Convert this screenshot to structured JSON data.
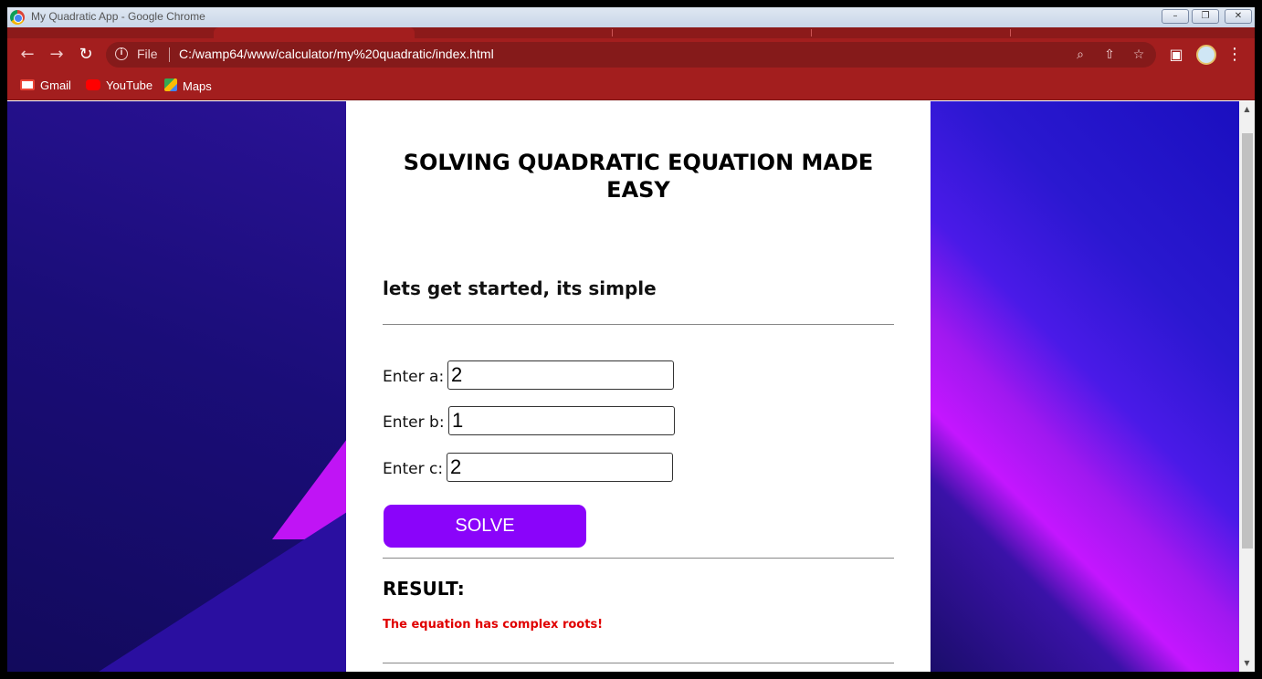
{
  "window": {
    "title": "My Quadratic App - Google Chrome",
    "controls": {
      "minimize": "–",
      "restore": "❐",
      "close": "✕"
    }
  },
  "toolbar": {
    "back_icon": "←",
    "forward_icon": "→",
    "reload_icon": "↻",
    "scheme_label": "File",
    "url": "C:/wamp64/www/calculator/my%20quadratic/index.html",
    "zoom_icon": "⌕",
    "share_icon": "⇧",
    "star_icon": "☆",
    "sidepanel_icon": "▣",
    "menu_icon": "⋮"
  },
  "bookmarks": [
    {
      "label": "Gmail",
      "icon": "gmail-icon",
      "color": "#ea4335"
    },
    {
      "label": "YouTube",
      "icon": "youtube-icon",
      "color": "#ff0000"
    },
    {
      "label": "Maps",
      "icon": "maps-icon",
      "color": "#34a853"
    }
  ],
  "page": {
    "title": "SOLVING QUADRATIC EQUATION MADE EASY",
    "subtitle": "lets get started, its simple",
    "fields": [
      {
        "label": "Enter a:",
        "value": "2"
      },
      {
        "label": "Enter b:",
        "value": "1"
      },
      {
        "label": "Enter c:",
        "value": "2"
      }
    ],
    "solve_label": "SOLVE",
    "result_heading": "RESULT:",
    "result_message": "The equation has complex roots!",
    "colors": {
      "button": "#8a04fa",
      "result": "#e00000"
    }
  }
}
